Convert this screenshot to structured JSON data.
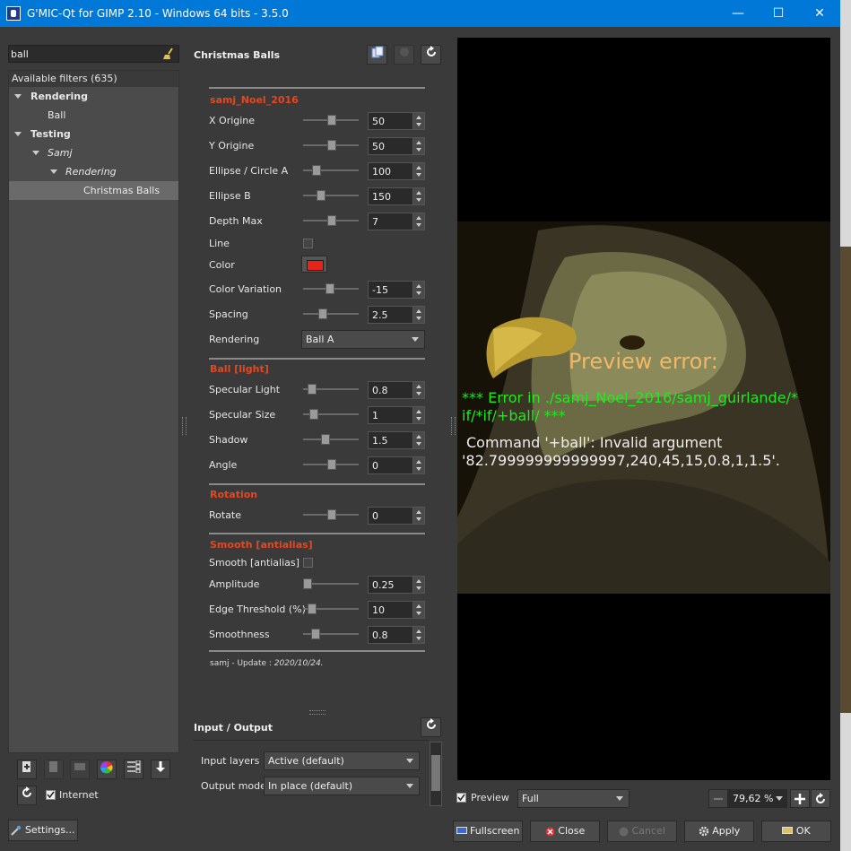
{
  "window": {
    "title": "G'MIC-Qt for GIMP 2.10 - Windows 64 bits - 3.5.0",
    "minimize": "—",
    "maximize": "☐",
    "close": "✕"
  },
  "left": {
    "search_value": "ball",
    "filters_header": "Available filters (635)",
    "tree": [
      {
        "label": "Rendering",
        "level": 0
      },
      {
        "label": "Ball",
        "level": 1
      },
      {
        "label": "Testing",
        "level": 0
      },
      {
        "label": "Samj",
        "level": 1
      },
      {
        "label": "Rendering",
        "level": 2
      },
      {
        "label": "Christmas Balls",
        "level": 3
      }
    ],
    "internet_label": "Internet",
    "settings_label": "Settings..."
  },
  "filter": {
    "name": "Christmas Balls",
    "sections": {
      "s1": "samj_Noel_2016",
      "s2": "Ball [light]",
      "s3": "Rotation",
      "s4": "Smooth [antialias]"
    },
    "params": {
      "x_origine": {
        "label": "X Origine",
        "value": "50"
      },
      "y_origine": {
        "label": "Y Origine",
        "value": "50"
      },
      "ellipse_a": {
        "label": "Ellipse / Circle A",
        "value": "100"
      },
      "ellipse_b": {
        "label": "Ellipse B",
        "value": "150"
      },
      "depth_max": {
        "label": "Depth Max",
        "value": "7"
      },
      "line": {
        "label": "Line"
      },
      "color": {
        "label": "Color",
        "swatch": "#e8231a"
      },
      "color_variation": {
        "label": "Color Variation",
        "value": "-15"
      },
      "spacing": {
        "label": "Spacing",
        "value": "2.5"
      },
      "rendering": {
        "label": "Rendering",
        "value": "Ball A"
      },
      "specular_light": {
        "label": "Specular Light",
        "value": "0.8"
      },
      "specular_size": {
        "label": "Specular Size",
        "value": "1"
      },
      "shadow": {
        "label": "Shadow",
        "value": "1.5"
      },
      "angle": {
        "label": "Angle",
        "value": "0"
      },
      "rotate": {
        "label": "Rotate",
        "value": "0"
      },
      "smooth": {
        "label": "Smooth [antialias]"
      },
      "amplitude": {
        "label": "Amplitude",
        "value": "0.25"
      },
      "edge": {
        "label": "Edge Threshold (%)",
        "value": "10"
      },
      "smoothness": {
        "label": "Smoothness",
        "value": "0.8"
      }
    },
    "author_prefix": "samj - Update : ",
    "author_date": "2020/10/24."
  },
  "io": {
    "title": "Input / Output",
    "input_label": "Input layers",
    "input_value": "Active (default)",
    "output_label": "Output mode",
    "output_value": "In place (default)"
  },
  "preview": {
    "error_title": "Preview error:",
    "error_line1": "*** Error in ./samj_Noel_2016/samj_guirlande/*",
    "error_line2": "if/*if/+ball/ ***",
    "cmd_line1": "Command '+ball': Invalid argument",
    "cmd_line2": "'82.799999999999997,240,45,15,0.8,1,1.5'.",
    "preview_label": "Preview",
    "mode_value": "Full",
    "zoom_value": "79,62 %"
  },
  "buttons": {
    "fullscreen": "Fullscreen",
    "close": "Close",
    "cancel": "Cancel",
    "apply": "Apply",
    "ok": "OK"
  },
  "colors": {
    "accent": "#e8461e",
    "error_green": "#22e822",
    "preview_title": "#f0b868"
  }
}
